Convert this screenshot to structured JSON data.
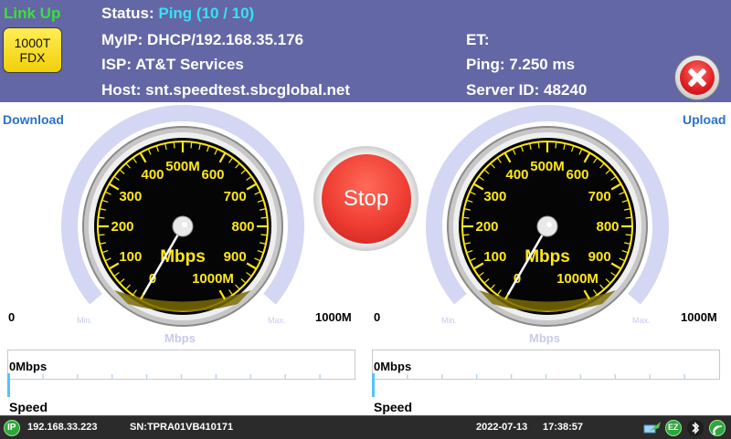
{
  "header": {
    "link_status": "Link Up",
    "speed_badge": {
      "line1": "1000T",
      "line2": "FDX"
    },
    "status_label": "Status:",
    "status_value": "Ping (10 / 10)",
    "myip": "MyIP: DHCP/192.168.35.176",
    "isp": "ISP: AT&T Services",
    "host": "Host: snt.speedtest.sbcglobal.net",
    "et": "ET:",
    "ping": "Ping: 7.250 ms",
    "server_id": "Server ID: 48240"
  },
  "download": {
    "title": "Download",
    "scale_min": "0",
    "scale_max": "1000M",
    "small_min": "Min.",
    "small_max": "Max.",
    "unit_under": "Mbps",
    "speed_value": "0Mbps",
    "speed_title": "Speed"
  },
  "upload": {
    "title": "Upload",
    "scale_min": "0",
    "scale_max": "1000M",
    "small_min": "Min.",
    "small_max": "Max.",
    "unit_under": "Mbps",
    "speed_value": "0Mbps",
    "speed_title": "Speed"
  },
  "gauge": {
    "tick_labels": [
      "0",
      "100",
      "200",
      "300",
      "400",
      "500M",
      "600",
      "700",
      "800",
      "900",
      "1000M"
    ],
    "unit": "Mbps",
    "download_value_mbps": 0,
    "upload_value_mbps": 0,
    "max_mbps": 1000
  },
  "stop_button": {
    "label": "Stop"
  },
  "status_bar": {
    "ip_badge": "IP",
    "ip": "192.168.33.223",
    "serial": "SN:TPRA01VB410171",
    "date": "2022-07-13",
    "time": "17:38:57",
    "ez_badge": "EZ",
    "icons": [
      "network-transfer-icon",
      "ez-icon",
      "bluetooth-icon",
      "wifi-icon"
    ]
  },
  "colors": {
    "header_bg": "#6467a5",
    "link_up": "#39e13a",
    "status_value": "#35e2f5",
    "section_label": "#2a72ca",
    "gauge_tick": "#ffe81a"
  }
}
